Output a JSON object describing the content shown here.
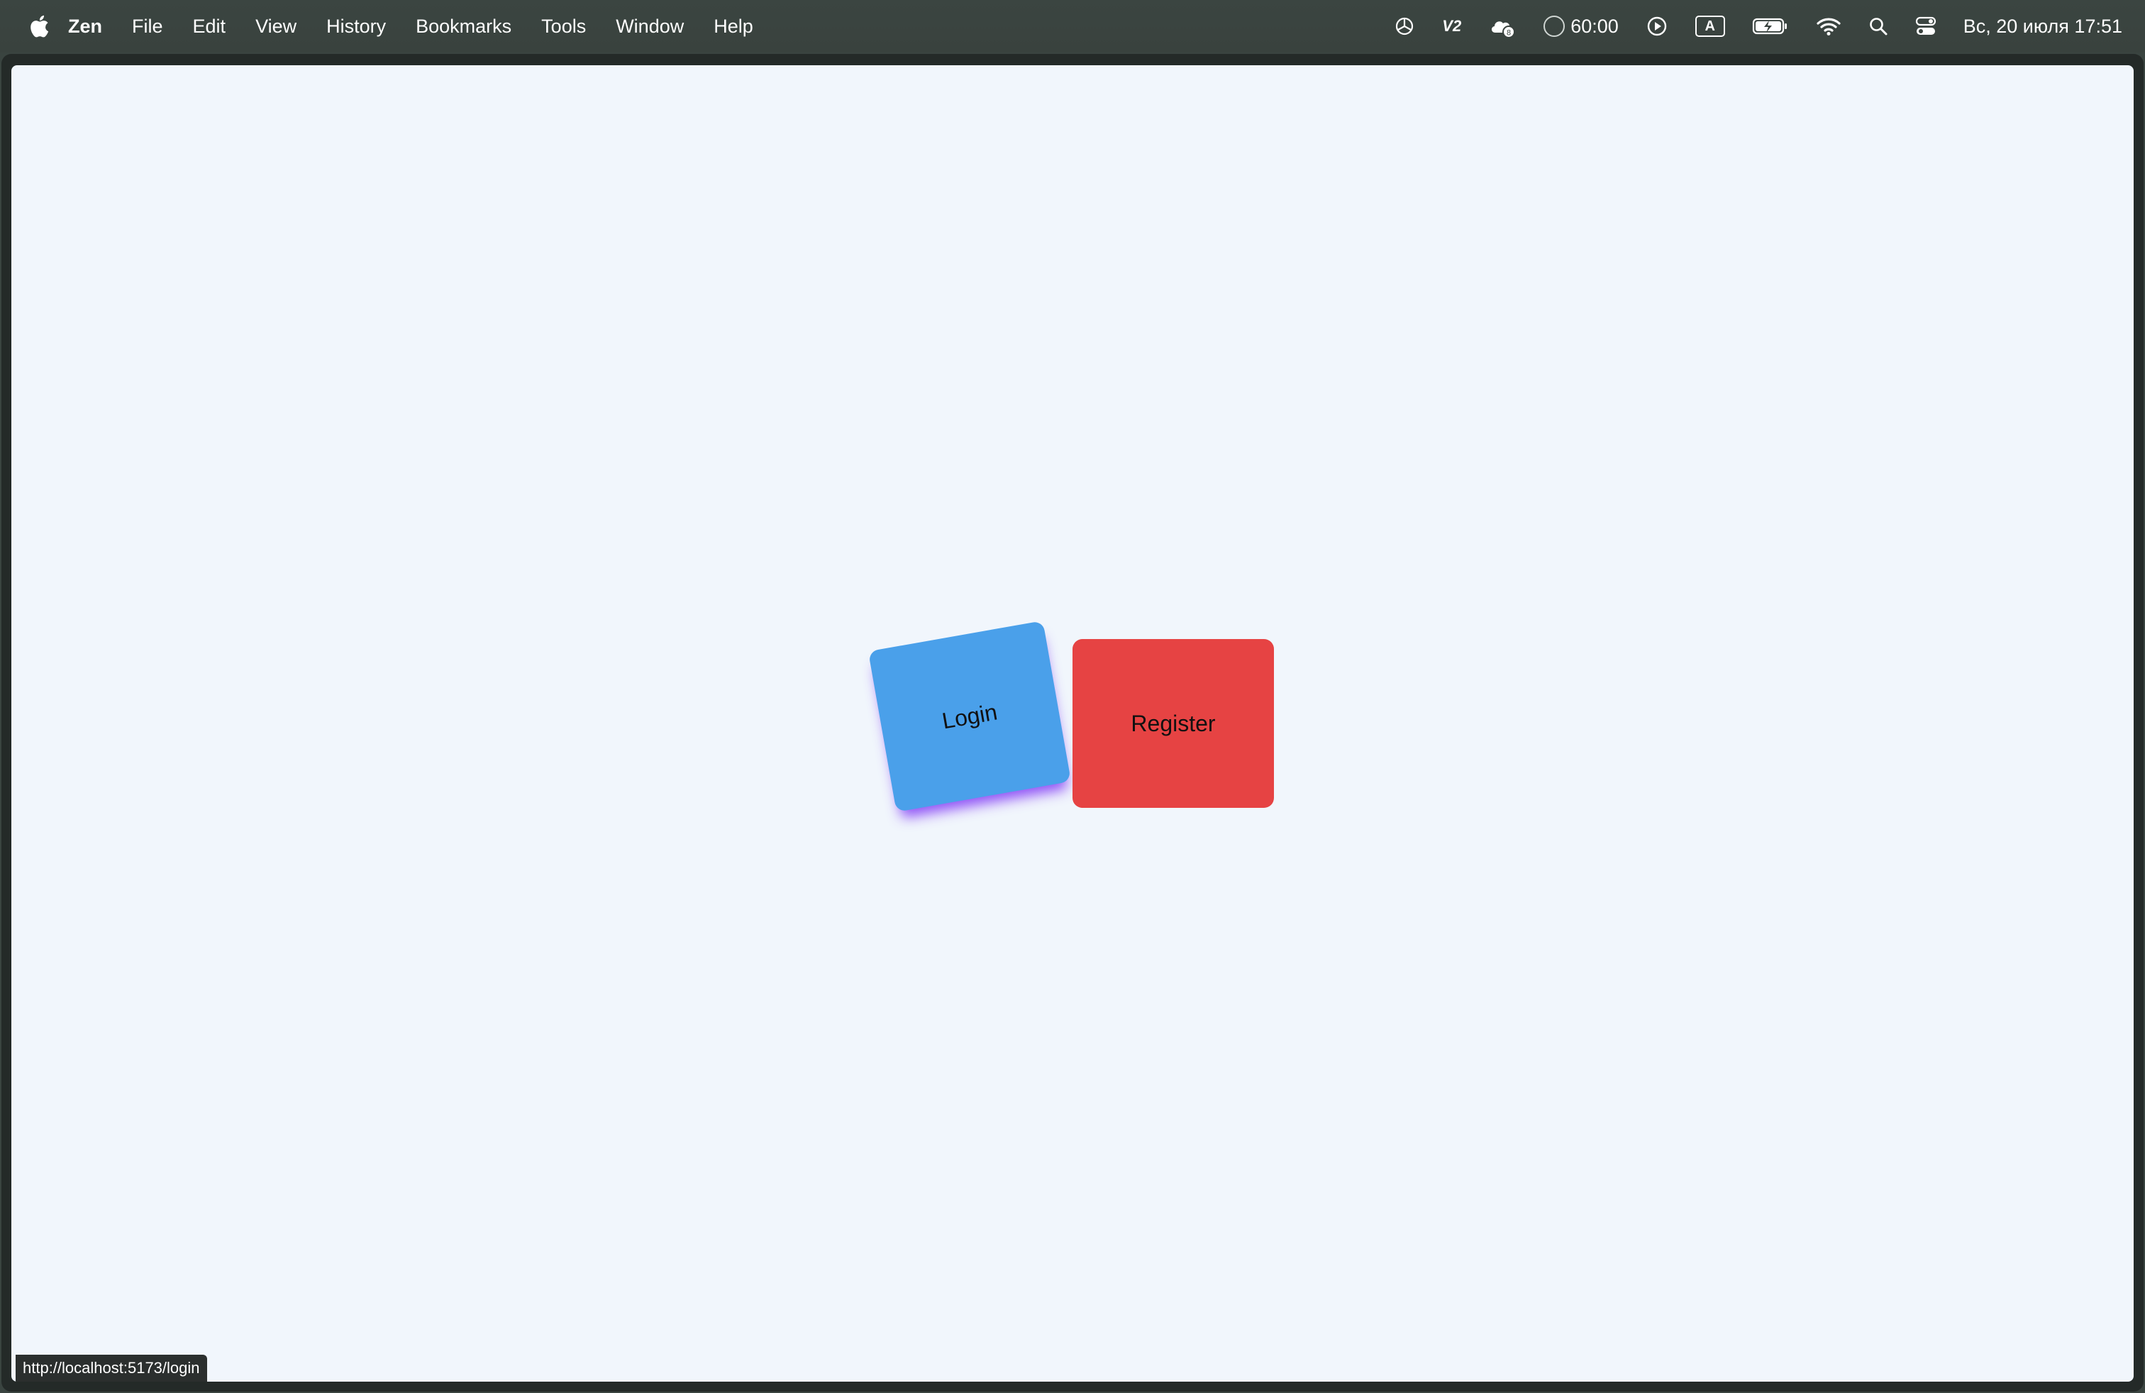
{
  "menubar": {
    "apple_icon": "apple-logo-icon",
    "app_name": "Zen",
    "items": [
      "File",
      "Edit",
      "View",
      "History",
      "Bookmarks",
      "Tools",
      "Window",
      "Help"
    ],
    "tray": {
      "v2_label": "V2",
      "badge_count": "8",
      "timer": "60:00",
      "input_source": "A",
      "datetime": "Вс, 20 июля  17:51"
    }
  },
  "page": {
    "login_label": "Login",
    "register_label": "Register",
    "status_url": "http://localhost:5173/login"
  },
  "colors": {
    "login_bg": "#4aa0ea",
    "login_shadow": "#8038f6",
    "register_bg": "#e64343",
    "page_bg": "#f1f6fc"
  }
}
